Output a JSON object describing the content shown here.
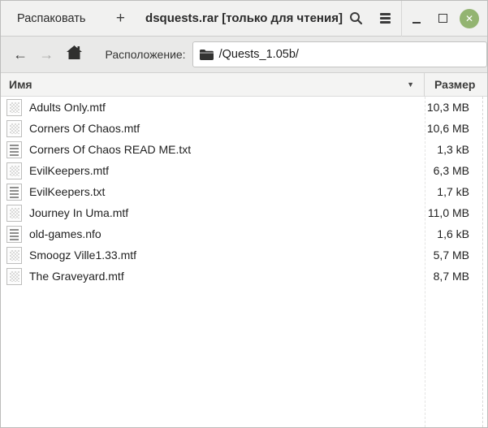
{
  "header": {
    "extract_button": "Распаковать",
    "add_button": "+",
    "title": "dsquests.rar [только для чтения]"
  },
  "toolbar": {
    "location_label": "Расположение:",
    "location_value": "/Quests_1.05b/"
  },
  "list": {
    "name_column": "Имя",
    "size_column": "Размер",
    "sort_indicator": "▼",
    "rows": [
      {
        "name": "Adults Only.mtf",
        "size": "10,3 MB",
        "icon": "binary-file-icon"
      },
      {
        "name": "Corners Of Chaos.mtf",
        "size": "10,6 MB",
        "icon": "binary-file-icon"
      },
      {
        "name": "Corners Of Chaos READ ME.txt",
        "size": "1,3 kB",
        "icon": "text-file-icon"
      },
      {
        "name": "EvilKeepers.mtf",
        "size": "6,3 MB",
        "icon": "binary-file-icon"
      },
      {
        "name": "EvilKeepers.txt",
        "size": "1,7 kB",
        "icon": "text-file-icon"
      },
      {
        "name": "Journey In Uma.mtf",
        "size": "11,0 MB",
        "icon": "binary-file-icon"
      },
      {
        "name": "old-games.nfo",
        "size": "1,6 kB",
        "icon": "text-file-icon"
      },
      {
        "name": "Smoogz Ville1.33.mtf",
        "size": "5,7 MB",
        "icon": "binary-file-icon"
      },
      {
        "name": "The Graveyard.mtf",
        "size": "8,7 MB",
        "icon": "binary-file-icon"
      }
    ]
  },
  "colors": {
    "close_button": "#93b471",
    "headerbar_bg": "#f1f1f0",
    "toolbar_bg": "#e9e9e8",
    "list_header_bg": "#f4f4f3",
    "text": "#1f1f1f"
  }
}
